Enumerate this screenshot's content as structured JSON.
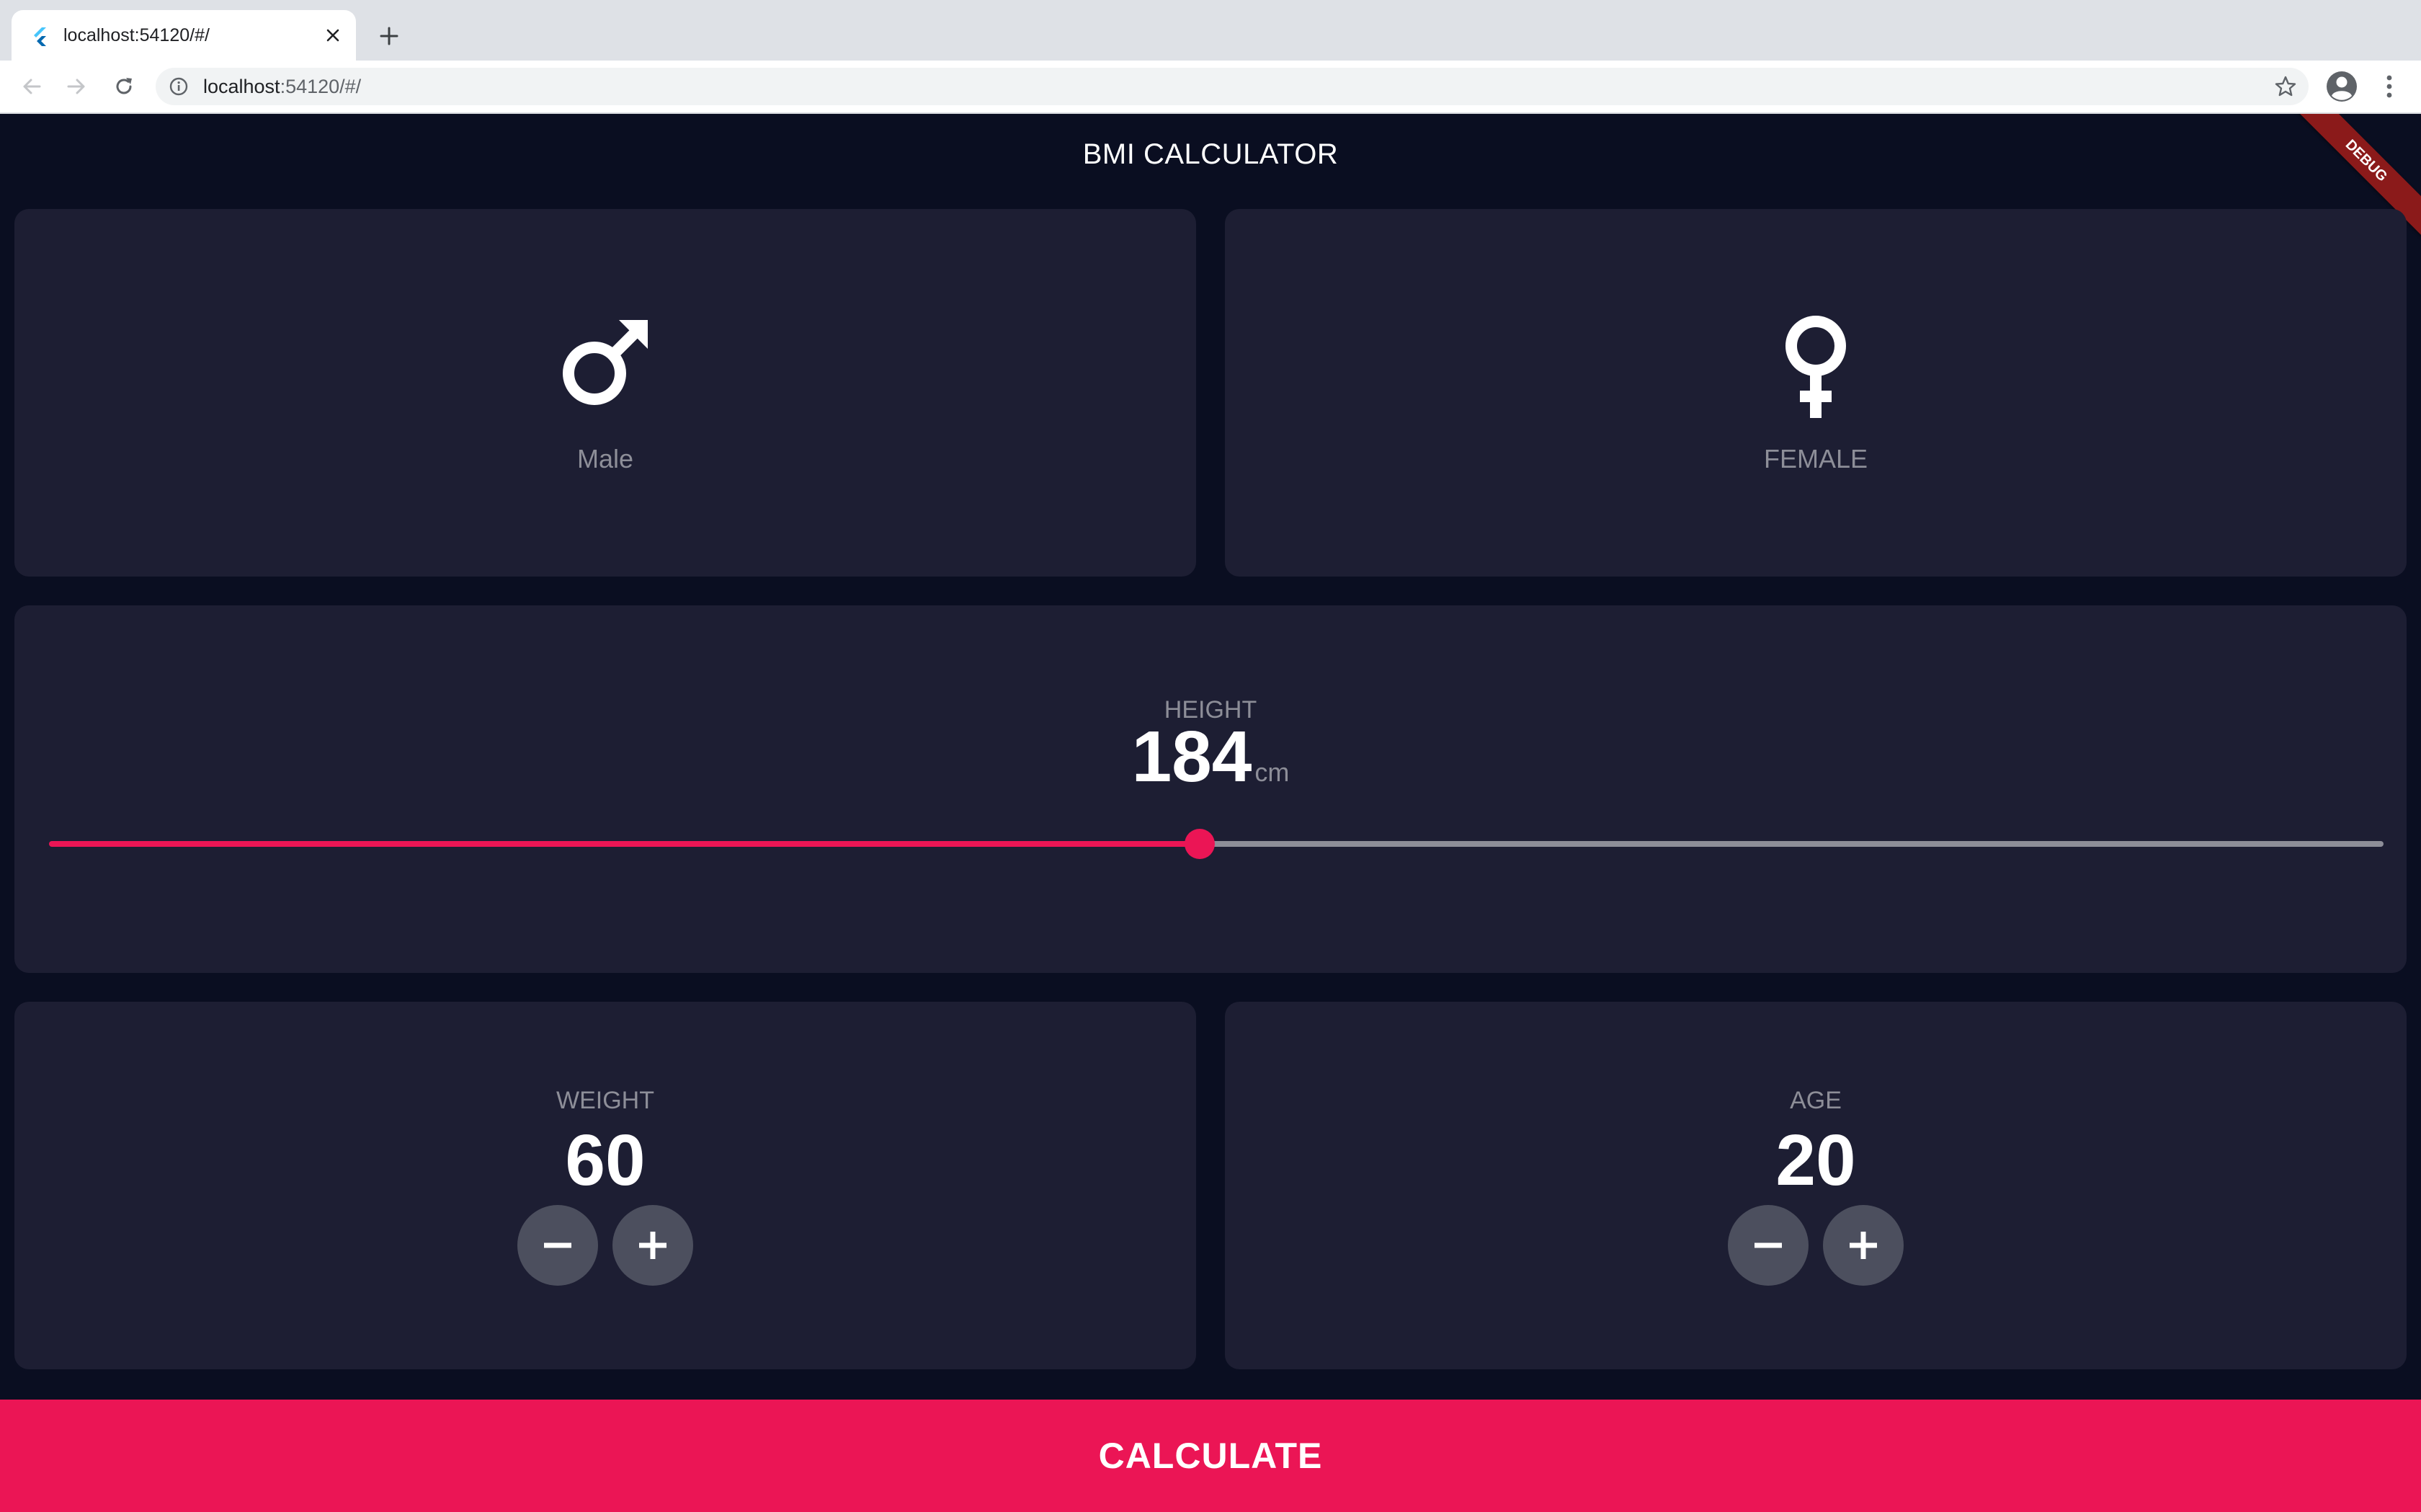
{
  "browser": {
    "tab_title": "localhost:54120/#/",
    "url_host": "localhost",
    "url_rest": ":54120/#/"
  },
  "app": {
    "title": "BMI CALCULATOR",
    "debug_banner": "DEBUG",
    "gender": {
      "male_label": "Male",
      "female_label": "FEMALE",
      "male_icon": "mars-icon",
      "female_icon": "venus-icon"
    },
    "height": {
      "label": "HEIGHT",
      "value": "184",
      "unit": "cm",
      "slider_fraction": 0.493
    },
    "weight": {
      "label": "WEIGHT",
      "value": "60"
    },
    "age": {
      "label": "AGE",
      "value": "20"
    },
    "calculate_label": "CALCULATE"
  },
  "colors": {
    "background": "#0a0e21",
    "card": "#1d1e33",
    "accent": "#eb1555",
    "label": "#8d8e98",
    "round_button": "#4c4f5e"
  }
}
